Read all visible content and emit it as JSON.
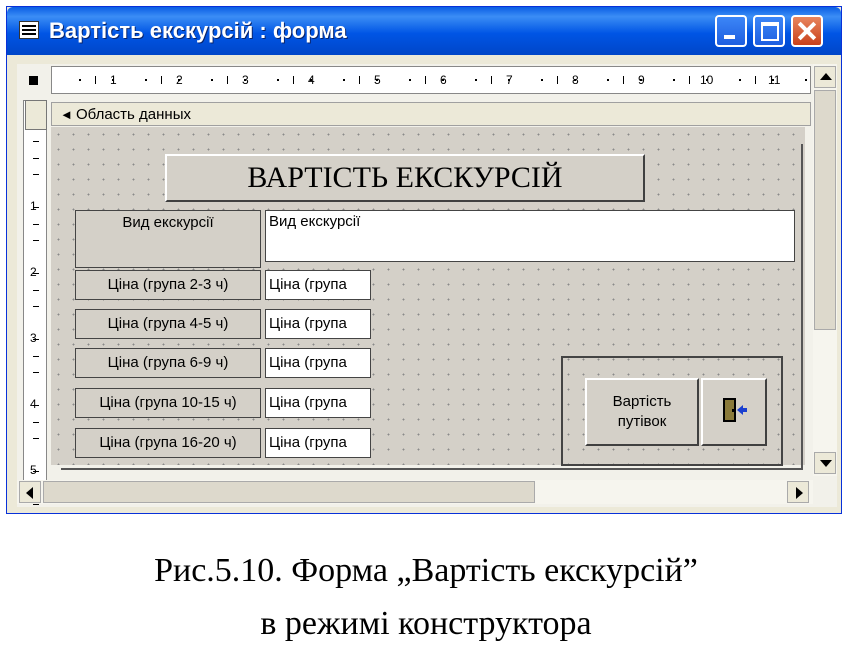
{
  "window": {
    "title": "Вартість екскурсій : форма"
  },
  "ruler": {
    "horizontal_numbers": [
      "1",
      "2",
      "3",
      "4",
      "5",
      "6",
      "7",
      "8",
      "9",
      "10",
      "11"
    ],
    "vertical_numbers": [
      "1",
      "2",
      "3",
      "4",
      "5"
    ]
  },
  "section": {
    "label": "Область данных"
  },
  "form": {
    "heading": "ВАРТІСТЬ ЕКСКУРСІЙ",
    "rows": [
      {
        "label": "Вид екскурсії",
        "field": "Вид екскурсії"
      },
      {
        "label": "Ціна (група 2-3 ч)",
        "field": "Ціна (група"
      },
      {
        "label": "Ціна (група 4-5 ч)",
        "field": "Ціна (група"
      },
      {
        "label": "Ціна (група 6-9 ч)",
        "field": "Ціна (група"
      },
      {
        "label": "Ціна (група 10-15 ч)",
        "field": "Ціна (група"
      },
      {
        "label": "Ціна (група 16-20 ч)",
        "field": "Ціна (група"
      }
    ],
    "button_cost_line1": "Вартість",
    "button_cost_line2": "путівок",
    "exit_icon": "exit-door-icon"
  },
  "caption": {
    "line1": "Рис.5.10. Форма „Вартість екскурсій”",
    "line2": "в режимі конструктора"
  }
}
